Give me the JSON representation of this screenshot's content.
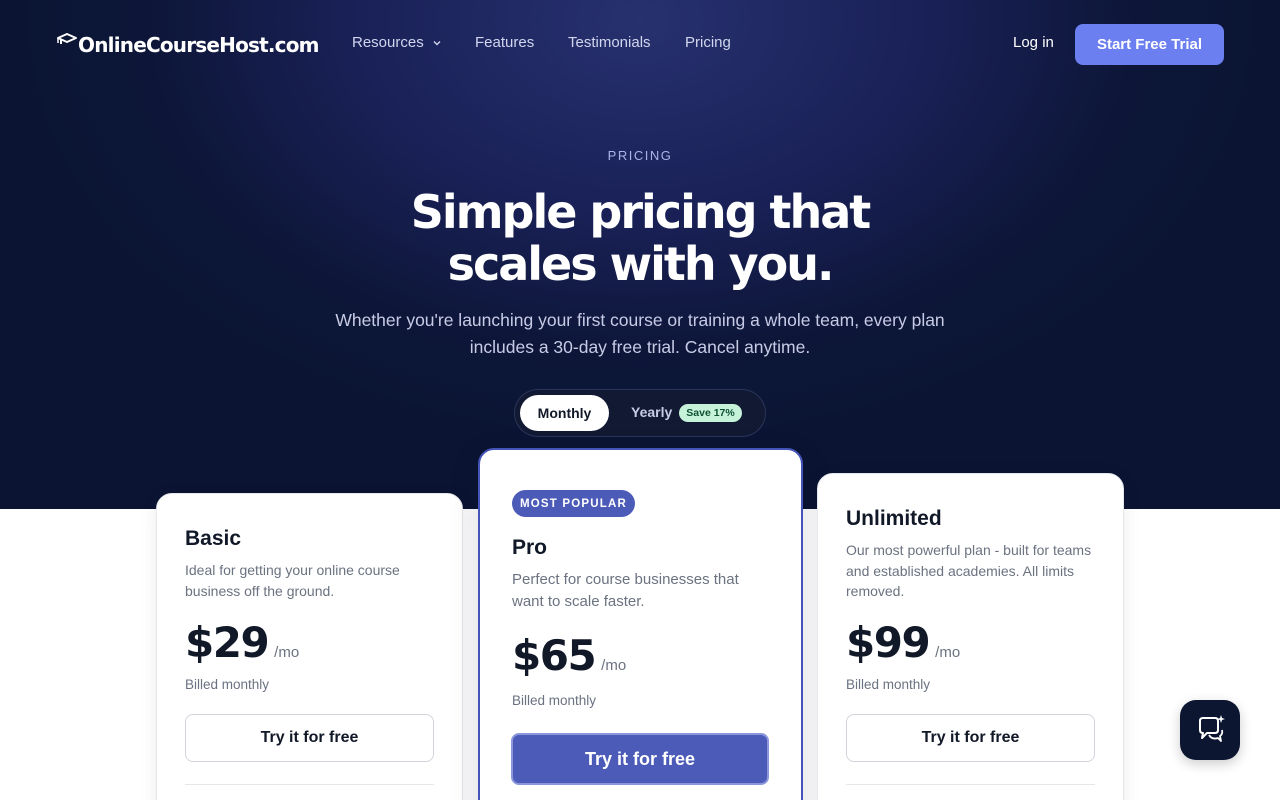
{
  "nav": {
    "logo_text": "OnlineCourseHost.com",
    "links": [
      {
        "label": "Resources"
      },
      {
        "label": "Features"
      },
      {
        "label": "Testimonials"
      },
      {
        "label": "Pricing"
      }
    ],
    "login_label": "Log in",
    "trial_label": "Start Free Trial"
  },
  "hero": {
    "eyebrow": "PRICING",
    "headline_line1": "Simple pricing that",
    "headline_line2": "scales with you.",
    "subhead_line1": "Whether you're launching your first course or training a whole team, every plan",
    "subhead_line2": "includes a 30-day free trial. Cancel anytime."
  },
  "billing_toggle": {
    "monthly": "Monthly",
    "yearly": "Yearly",
    "save_badge": "Save 17%"
  },
  "plans": [
    {
      "name": "Basic",
      "description": "Ideal for getting your online course business off the ground.",
      "price": "$29",
      "period": "/mo",
      "billed": "Billed monthly",
      "cta": "Try it for free"
    },
    {
      "badge": "MOST POPULAR",
      "name": "Pro",
      "description": "Perfect for course businesses that want to scale faster.",
      "price": "$65",
      "period": "/mo",
      "billed": "Billed monthly",
      "cta": "Try it for free"
    },
    {
      "name": "Unlimited",
      "description": "Our most powerful plan - built for teams and established academies. All limits removed.",
      "price": "$99",
      "period": "/mo",
      "billed": "Billed monthly",
      "cta": "Try it for free"
    }
  ],
  "colors": {
    "hero_bg": "#0b1533",
    "accent": "#6b7ff0",
    "pro_accent": "#4c5bb8",
    "save_badge_bg": "#c6f2da"
  },
  "icons": {
    "logo": "graduation-cap-icon",
    "resources_dropdown": "chevron-down-icon",
    "chat": "chat-bubble-sparkle-icon"
  }
}
